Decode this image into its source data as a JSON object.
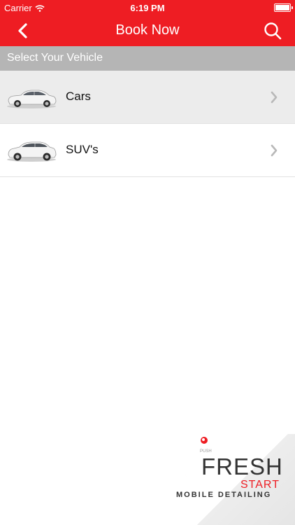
{
  "status_bar": {
    "carrier": "Carrier",
    "time": "6:19 PM"
  },
  "nav": {
    "title": "Book Now"
  },
  "section": {
    "header": "Select Your Vehicle"
  },
  "vehicles": [
    {
      "label": "Cars"
    },
    {
      "label": "SUV's"
    }
  ],
  "logo": {
    "fresh": "FRESH",
    "start": "START",
    "tagline": "MOBILE DETAILING",
    "push": "PUSH"
  },
  "colors": {
    "accent": "#ee1d23",
    "section_header": "#b5b5b5",
    "selected_row": "#ececec"
  }
}
